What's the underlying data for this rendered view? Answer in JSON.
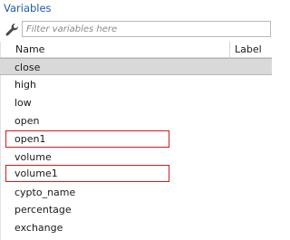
{
  "panel": {
    "title": "Variables"
  },
  "filter": {
    "placeholder": "Filter variables here",
    "value": ""
  },
  "columns": {
    "name": "Name",
    "label": "Label"
  },
  "variables": [
    {
      "name": "close",
      "selected": true
    },
    {
      "name": "high"
    },
    {
      "name": "low"
    },
    {
      "name": "open"
    },
    {
      "name": "open1",
      "highlighted": true
    },
    {
      "name": "volume"
    },
    {
      "name": "volume1",
      "highlighted": true
    },
    {
      "name": "cypto_name"
    },
    {
      "name": "percentage"
    },
    {
      "name": "exchange"
    }
  ],
  "colors": {
    "title": "#1f5aa6",
    "selection": "#d9d9d9",
    "highlight_frame": "#d11b1b"
  },
  "icons": {
    "filter": "wrench-icon"
  }
}
